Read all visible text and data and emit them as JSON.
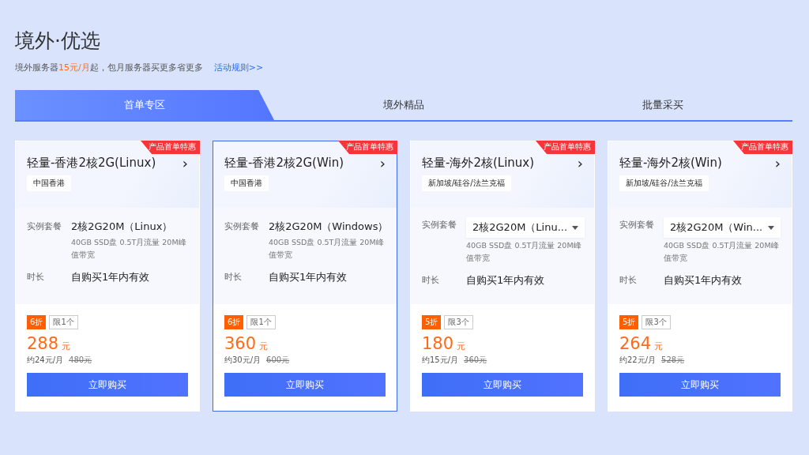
{
  "header": {
    "title": "境外·优选",
    "subtitle": "境外服务器**15元/月**起，包月服务器买更多省更多",
    "rules_link": "活动规则>>"
  },
  "tabs": [
    {
      "label": "首单专区",
      "selected": true
    },
    {
      "label": "境外精品",
      "selected": false
    },
    {
      "label": "批量采买",
      "selected": false
    }
  ],
  "cards": [
    {
      "ribbon": "产品首单特惠",
      "name": "轻量-香港2核2G(Linux)",
      "chevron": "›",
      "region": "中国香港",
      "plan_label": "实例套餐",
      "plan": {
        "kind": "text",
        "value": "2核2G20M（Linux）"
      },
      "plan_desc": "40GB SSD盘 0.5T月流量 20M峰值带宽",
      "duration_label": "时长",
      "duration": "自购买1年内有效",
      "discount": "6折",
      "limit": "限1个",
      "price": "288",
      "unit": "元",
      "monthly": "约24元/月",
      "original": "480元",
      "buy": "立即购买",
      "selected": false
    },
    {
      "ribbon": "产品首单特惠",
      "name": "轻量-香港2核2G(Win)",
      "chevron": "›",
      "region": "中国香港",
      "plan_label": "实例套餐",
      "plan": {
        "kind": "text",
        "value": "2核2G20M（Windows）"
      },
      "plan_desc": "40GB SSD盘 0.5T月流量 20M峰值带宽",
      "duration_label": "时长",
      "duration": "自购买1年内有效",
      "discount": "6折",
      "limit": "限1个",
      "price": "360",
      "unit": "元",
      "monthly": "约30元/月",
      "original": "600元",
      "buy": "立即购买",
      "selected": true
    },
    {
      "ribbon": "产品首单特惠",
      "name": "轻量-海外2核(Linux)",
      "chevron": "›",
      "region": "新加坡/硅谷/法兰克福",
      "plan_label": "实例套餐",
      "plan": {
        "kind": "select",
        "value": "2核2G20M（Linu..."
      },
      "plan_desc": "40GB SSD盘 0.5T月流量 20M峰值带宽",
      "duration_label": "时长",
      "duration": "自购买1年内有效",
      "discount": "5折",
      "limit": "限3个",
      "price": "180",
      "unit": "元",
      "monthly": "约15元/月",
      "original": "360元",
      "buy": "立即购买",
      "selected": false
    },
    {
      "ribbon": "产品首单特惠",
      "name": "轻量-海外2核(Win)",
      "chevron": "›",
      "region": "新加坡/硅谷/法兰克福",
      "plan_label": "实例套餐",
      "plan": {
        "kind": "select",
        "value": "2核2G20M（Win..."
      },
      "plan_desc": "40GB SSD盘 0.5T月流量 20M峰值带宽",
      "duration_label": "时长",
      "duration": "自购买1年内有效",
      "discount": "5折",
      "limit": "限3个",
      "price": "264",
      "unit": "元",
      "monthly": "约22元/月",
      "original": "528元",
      "buy": "立即购买",
      "selected": false
    }
  ]
}
